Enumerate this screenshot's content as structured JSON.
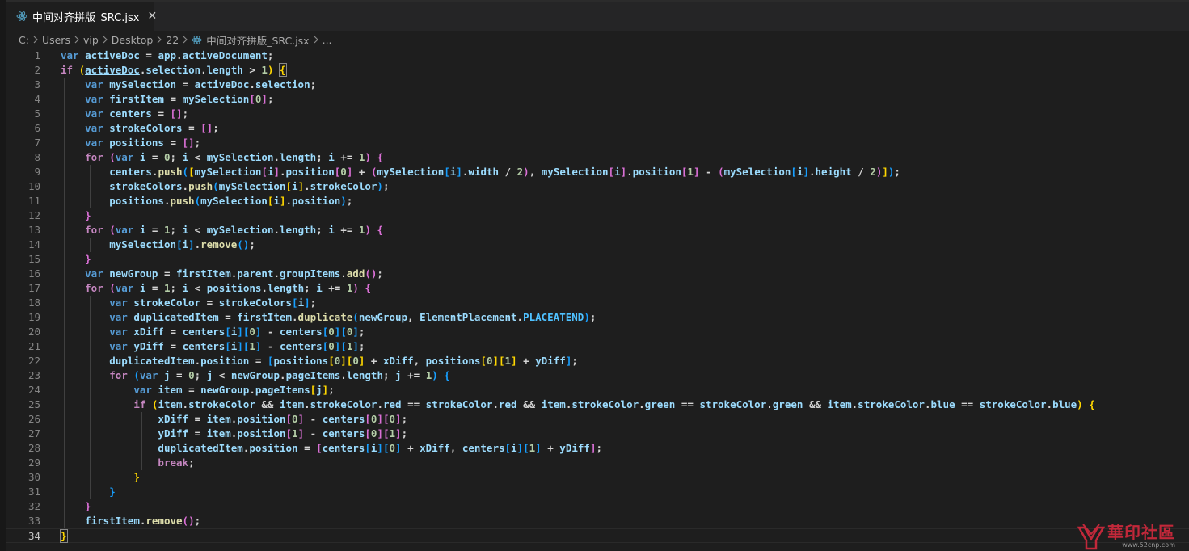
{
  "tab": {
    "label": "中间对齐拼版_SRC.jsx",
    "close": "✕"
  },
  "breadcrumb": {
    "items": [
      "C:",
      "Users",
      "vip",
      "Desktop",
      "22",
      "中间对齐拼版_SRC.jsx",
      "..."
    ]
  },
  "line_numbers": [
    "1",
    "2",
    "3",
    "4",
    "5",
    "6",
    "7",
    "8",
    "9",
    "10",
    "11",
    "12",
    "13",
    "14",
    "15",
    "16",
    "17",
    "18",
    "19",
    "20",
    "21",
    "22",
    "23",
    "24",
    "25",
    "26",
    "27",
    "28",
    "29",
    "30",
    "31",
    "32",
    "33",
    "34"
  ],
  "code_lines": [
    "var activeDoc = app.activeDocument;",
    "if (activeDoc.selection.length > 1) {",
    "    var mySelection = activeDoc.selection;",
    "    var firstItem = mySelection[0];",
    "    var centers = [];",
    "    var strokeColors = [];",
    "    var positions = [];",
    "    for (var i = 0; i < mySelection.length; i += 1) {",
    "        centers.push([mySelection[i].position[0] + (mySelection[i].width / 2), mySelection[i].position[1] - (mySelection[i].height / 2)]);",
    "        strokeColors.push(mySelection[i].strokeColor);",
    "        positions.push(mySelection[i].position);",
    "    }",
    "    for (var i = 1; i < mySelection.length; i += 1) {",
    "        mySelection[i].remove();",
    "    }",
    "    var newGroup = firstItem.parent.groupItems.add();",
    "    for (var i = 1; i < positions.length; i += 1) {",
    "        var strokeColor = strokeColors[i];",
    "        var duplicatedItem = firstItem.duplicate(newGroup, ElementPlacement.PLACEATEND);",
    "        var xDiff = centers[i][0] - centers[0][0];",
    "        var yDiff = centers[i][1] - centers[0][1];",
    "        duplicatedItem.position = [positions[0][0] + xDiff, positions[0][1] + yDiff];",
    "        for (var j = 0; j < newGroup.pageItems.length; j += 1) {",
    "            var item = newGroup.pageItems[j];",
    "            if (item.strokeColor && item.strokeColor.red == strokeColor.red && item.strokeColor.green == strokeColor.green && item.strokeColor.blue == strokeColor.blue) {",
    "                xDiff = item.position[0] - centers[0][0];",
    "                yDiff = item.position[1] - centers[0][1];",
    "                duplicatedItem.position = [centers[i][0] + xDiff, centers[i][1] + yDiff];",
    "                break;",
    "            }",
    "        }",
    "    }",
    "    firstItem.remove();",
    "}"
  ],
  "active_line": 34,
  "watermark": {
    "text": "華印社區",
    "url": "www.52cnp.com"
  },
  "colors": {
    "background": "#1e1e1e",
    "keyword": "#569cd6",
    "control": "#c586c0",
    "variable": "#9cdcfe",
    "function": "#dcdcaa",
    "number": "#b5cea8",
    "bracket_gold": "#ffd700",
    "bracket_orchid": "#da70d6",
    "bracket_blue": "#179fff",
    "watermark_red": "#c2283a"
  }
}
